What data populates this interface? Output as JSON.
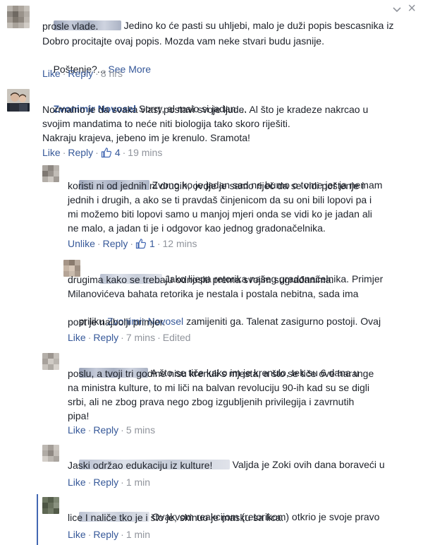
{
  "top": {
    "text_l1": "Jedino ko će pasti su uhljebi, malo je duži popis bescasnika iz",
    "text_l2": "prosle vlade.",
    "text_l3": "Dobro procitajte ovaj popis. Mozda vam neke stvari budu jasnije.",
    "text_l4a": "Poštenje?...",
    "see_more": "See More",
    "like": "Like",
    "reply": "Reply",
    "time": "8 hrs"
  },
  "zvonimir": {
    "name": "Zvonimir Novosel",
    "text_l1": "Sorry, al malo si jadan....",
    "text_l2": "Normalno je da svaka vlast postavi svoje ljude. Al što je kradeze nakrcao u",
    "text_l3": "svojim mandatima to neće niti biologija tako skoro riješiti.",
    "text_l4": "Nakraju krajeva, jebeno im je krenulo. Sramota!",
    "like": "Like",
    "reply": "Reply",
    "likes": "4",
    "time": "19 mins"
  },
  "r1": {
    "lines": [
      "Zvono ko je jadan sad ne bumo o tome jer ja nemam",
      "koristi ni od jednih ni drugih, ovdje je samo riječ da se vidi poštenje i",
      "jednih i drugih, a ako se ti pravdaš činjenicom da su oni bili lopovi pa i",
      "mi možemo biti lopovi samo u manjoj mjeri onda se vidi ko je jadan ali",
      "ne malo, a jadan ti je i odgovor kao jednog gradonačelnika."
    ],
    "unlike": "Unlike",
    "reply": "Reply",
    "likes": "1",
    "time": "12 mins"
  },
  "r2": {
    "l1": "Jako lijepa retorika našeg gradonačelnika. Primjer",
    "l2": "drugima kako se trebaju odnositi prema svojim sugrađanima.",
    "l3": "Milanovićeva bahata retorika je nestala i postala nebitna, sada ima",
    "l4a": "priliku",
    "l4name": "Zvonimir Novosel",
    "l4b": "zamijeniti ga. Talenat zasigurno postoji. Ovaj",
    "l5": "post je najbolji primjer.",
    "like": "Like",
    "reply": "Reply",
    "time": "7 mins",
    "edited": "Edited"
  },
  "r3": {
    "lines": [
      "A što se tiče kako im je krenulo, tek su 6 dana u",
      "poslu, a tvoji tri godine nisu krenuli s mjesta, a što se tiče ove harange",
      "na ministra kulture, to mi liči na balvan revoluciju 90-ih kad su se digli",
      "srbi, ali ne zbog prava nego zbog izgubljenih privilegija i zavrnutih",
      "pipa!"
    ],
    "like": "Like",
    "reply": "Reply",
    "time": "5 mins"
  },
  "r4": {
    "lines": [
      "Valjda je Zoki ovih dana boraveći u",
      "Jaski održao edukaciju iz kulture!"
    ],
    "like": "Like",
    "reply": "Reply",
    "time": "1 min"
  },
  "r5": {
    "lines": [
      "Ovakvom reakcijom (retorikom) otkrio je svoje pravo",
      "lice I naliče tko je i što je, skinuo je masku sa lica."
    ],
    "like": "Like",
    "reply": "Reply",
    "time": "1 min"
  }
}
